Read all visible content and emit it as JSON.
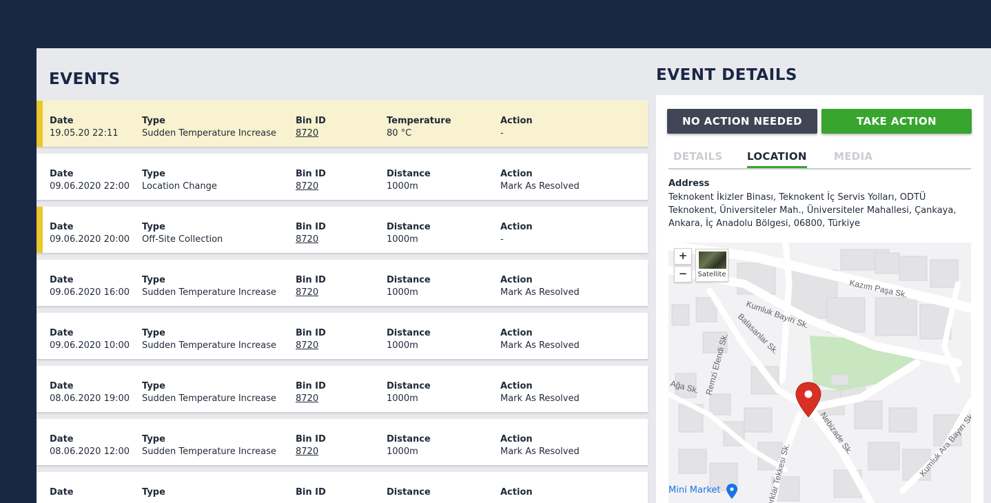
{
  "events": {
    "title": "EVENTS",
    "items": [
      {
        "date_label": "Date",
        "date": "19.05.20  22:11",
        "type_label": "Type",
        "type": "Sudden Temperature Increase",
        "bin_label": "Bin ID",
        "bin": "8720",
        "metric_label": "Temperature",
        "metric": "80 °C",
        "action_label": "Action",
        "action": "-",
        "highlighted": true,
        "flagged": true
      },
      {
        "date_label": "Date",
        "date": "09.06.2020 22:00",
        "type_label": "Type",
        "type": "Location Change",
        "bin_label": "Bin ID",
        "bin": "8720",
        "metric_label": "Distance",
        "metric": "1000m",
        "action_label": "Action",
        "action": "Mark As Resolved",
        "highlighted": false,
        "flagged": false
      },
      {
        "date_label": "Date",
        "date": "09.06.2020 20:00",
        "type_label": "Type",
        "type": "Off-Site Collection",
        "bin_label": "Bin ID",
        "bin": "8720",
        "metric_label": "Distance",
        "metric": "1000m",
        "action_label": "Action",
        "action": "-",
        "highlighted": false,
        "flagged": true
      },
      {
        "date_label": "Date",
        "date": "09.06.2020 16:00",
        "type_label": "Type",
        "type": "Sudden Temperature Increase",
        "bin_label": "Bin ID",
        "bin": "8720",
        "metric_label": "Distance",
        "metric": "1000m",
        "action_label": "Action",
        "action": "Mark As Resolved",
        "highlighted": false,
        "flagged": false
      },
      {
        "date_label": "Date",
        "date": "09.06.2020 10:00",
        "type_label": "Type",
        "type": "Sudden Temperature Increase",
        "bin_label": "Bin ID",
        "bin": "8720",
        "metric_label": "Distance",
        "metric": "1000m",
        "action_label": "Action",
        "action": "Mark As Resolved",
        "highlighted": false,
        "flagged": false
      },
      {
        "date_label": "Date",
        "date": "08.06.2020 19:00",
        "type_label": "Type",
        "type": "Sudden Temperature Increase",
        "bin_label": "Bin ID",
        "bin": "8720",
        "metric_label": "Distance",
        "metric": "1000m",
        "action_label": "Action",
        "action": "Mark As Resolved",
        "highlighted": false,
        "flagged": false
      },
      {
        "date_label": "Date",
        "date": "08.06.2020 12:00",
        "type_label": "Type",
        "type": "Sudden Temperature Increase",
        "bin_label": "Bin ID",
        "bin": "8720",
        "metric_label": "Distance",
        "metric": "1000m",
        "action_label": "Action",
        "action": "Mark As Resolved",
        "highlighted": false,
        "flagged": false
      },
      {
        "date_label": "Date",
        "date": "",
        "type_label": "Type",
        "type": "",
        "bin_label": "Bin ID",
        "bin": "",
        "metric_label": "Distance",
        "metric": "",
        "action_label": "Action",
        "action": "",
        "highlighted": false,
        "flagged": false
      }
    ]
  },
  "details": {
    "title": "EVENT DETAILS",
    "no_action_label": "NO ACTION NEEDED",
    "take_action_label": "TAKE ACTION",
    "tabs": [
      {
        "label": "DETAILS",
        "active": false
      },
      {
        "label": "LOCATION",
        "active": true
      },
      {
        "label": "MEDIA",
        "active": false
      }
    ],
    "address_label": "Address",
    "address": "Teknokent İkizler Binası, Teknokent İç Servis Yolları, ODTÜ Teknokent, Üniversiteler Mah., Üniversiteler Mahallesi, Çankaya, Ankara, İç Anadolu Bölgesi, 06800, Türkiye"
  },
  "map": {
    "zoom_in": "+",
    "zoom_out": "−",
    "satellite_label": "Satellite",
    "streets": [
      "Kazım Paşa Sk.",
      "Kumluk Bayırı Sk.",
      "Balasanlar Sk.",
      "Remzi Efendi Sk.",
      "Nebizade Sk.",
      "Kumluk Ara Bayırı Sk.",
      "Kırklar Tekkesi Sk.",
      "Ağa Sk."
    ],
    "poi": "Mini Market",
    "marker_color": "#d93025",
    "park_color": "#c8e6c0"
  },
  "colors": {
    "header_bg": "#1a2744",
    "accent_green": "#38a52e",
    "flag_yellow": "#ecc72c",
    "highlight_bg": "#f8f2d0"
  }
}
